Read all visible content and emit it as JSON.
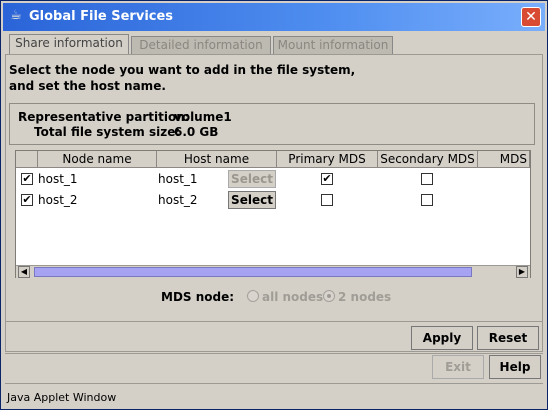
{
  "window": {
    "title": "Global File Services",
    "close_symbol": "✕"
  },
  "tabs": [
    {
      "label": "Share information",
      "active": true
    },
    {
      "label": "Detailed information",
      "active": false
    },
    {
      "label": "Mount information",
      "active": false
    }
  ],
  "instruction": {
    "line1": "Select the node you want to add in the file system,",
    "line2": "and set the host name."
  },
  "info": {
    "representative_partition_label": "Representative partition:",
    "representative_partition_value": "volume1",
    "total_size_label": "Total file system size:",
    "total_size_value": "6.0 GB"
  },
  "table": {
    "headers": [
      "Node name",
      "Host name",
      "Primary MDS",
      "Secondary MDS",
      "MDS"
    ],
    "rows": [
      {
        "node_checked": true,
        "node_name": "host_1",
        "host_name": "host_1",
        "select_label": "Select",
        "select_enabled": false,
        "primary_mds": true,
        "secondary_mds": false
      },
      {
        "node_checked": true,
        "node_name": "host_2",
        "host_name": "host_2",
        "select_label": "Select",
        "select_enabled": true,
        "primary_mds": false,
        "secondary_mds": false
      }
    ]
  },
  "mds_node": {
    "label": "MDS node:",
    "options": [
      "all nodes",
      "2 nodes"
    ],
    "selected": "2 nodes"
  },
  "buttons": {
    "apply": "Apply",
    "reset": "Reset",
    "exit": "Exit",
    "help": "Help"
  },
  "status_bar": {
    "text": "Java Applet Window"
  },
  "colors": {
    "titlebar_start": "#2a64d8",
    "titlebar_end": "#79aefc",
    "scroll_thumb": "#a6a4f2"
  }
}
